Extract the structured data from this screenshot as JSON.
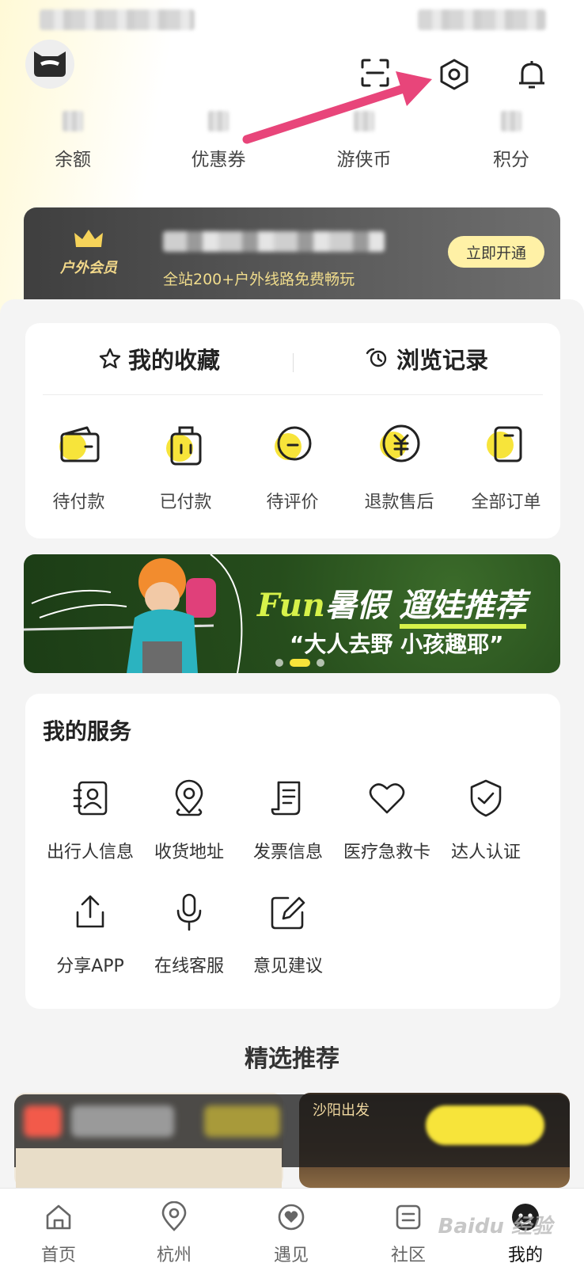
{
  "header": {
    "avatar_icon": "avatar-icon",
    "icons": [
      "scan-icon",
      "settings-icon",
      "bell-icon"
    ]
  },
  "stats": [
    {
      "label": "余额"
    },
    {
      "label": "优惠券"
    },
    {
      "label": "游侠币"
    },
    {
      "label": "积分"
    }
  ],
  "vip": {
    "badge_label": "户外会员",
    "desc": "全站200+户外线路免费畅玩",
    "button": "立即开通"
  },
  "favorites": {
    "tabs": [
      "我的收藏",
      "浏览记录"
    ],
    "orders": [
      {
        "label": "待付款",
        "icon": "wallet-icon"
      },
      {
        "label": "已付款",
        "icon": "bag-icon"
      },
      {
        "label": "待评价",
        "icon": "comment-icon"
      },
      {
        "label": "退款售后",
        "icon": "refund-icon"
      },
      {
        "label": "全部订单",
        "icon": "orders-icon"
      }
    ]
  },
  "banner": {
    "title_fun": "Fun",
    "title_rest": "暑假 ",
    "title_hl": "遛娃推荐",
    "subtitle": "“大人去野 小孩趣耶”",
    "active_slide": 2,
    "slide_count": 3
  },
  "services": {
    "title": "我的服务",
    "items": [
      {
        "label": "出行人信息",
        "icon": "traveler-info-icon"
      },
      {
        "label": "收货地址",
        "icon": "location-icon"
      },
      {
        "label": "发票信息",
        "icon": "invoice-icon"
      },
      {
        "label": "医疗急救卡",
        "icon": "heart-icon"
      },
      {
        "label": "达人认证",
        "icon": "shield-check-icon"
      },
      {
        "label": "分享APP",
        "icon": "share-icon"
      },
      {
        "label": "在线客服",
        "icon": "microphone-icon"
      },
      {
        "label": "意见建议",
        "icon": "edit-icon"
      }
    ]
  },
  "recommend": {
    "title": "精选推荐",
    "right_card_label": "沙阳出发"
  },
  "tabbar": {
    "tabs": [
      {
        "label": "首页",
        "icon": "home-icon"
      },
      {
        "label": "杭州",
        "icon": "location-pin-icon"
      },
      {
        "label": "遇见",
        "icon": "meet-icon"
      },
      {
        "label": "社区",
        "icon": "community-icon"
      },
      {
        "label": "我的",
        "icon": "profile-icon"
      }
    ],
    "active": "我的"
  },
  "watermark": "Baidu 经验",
  "colors": {
    "accent_yellow": "#f7e43a",
    "arrow_pink": "#e8457a",
    "vip_gold": "#f0dc8c"
  }
}
